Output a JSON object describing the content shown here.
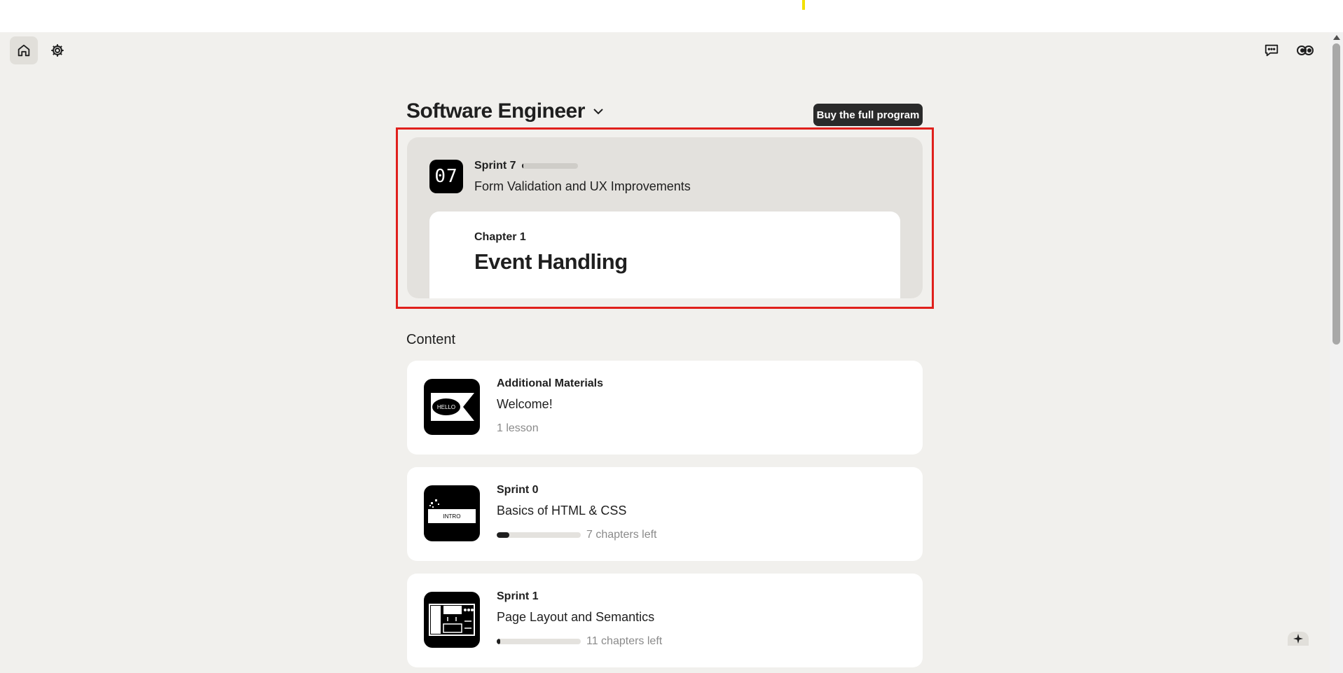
{
  "program": {
    "title": "Software Engineer",
    "buy_label": "Buy the full program"
  },
  "current_sprint": {
    "badge": "07",
    "label": "Sprint 7",
    "progress": 0.03,
    "name": "Form Validation and UX Improvements",
    "chapter_label": "Chapter 1",
    "chapter_title": "Event Handling"
  },
  "content": {
    "heading": "Content",
    "items": [
      {
        "kicker": "Additional Materials",
        "title": "Welcome!",
        "meta": "1 lesson",
        "thumb_text": "HELLO"
      },
      {
        "kicker": "Sprint 0",
        "title": "Basics of HTML & CSS",
        "meta": "7 chapters left",
        "progress": 0.15,
        "thumb_text": "INTRO"
      },
      {
        "kicker": "Sprint 1",
        "title": "Page Layout and Semantics",
        "meta": "11 chapters left",
        "progress": 0.04
      }
    ]
  },
  "icons": {
    "home": "home-icon",
    "settings": "gear-icon",
    "chat": "chat-icon",
    "mascot": "mascot-icon",
    "dropdown": "chevron-down-icon"
  },
  "colors": {
    "background": "#f1f0ed",
    "accent_dark": "#2a2a2a",
    "highlight": "#e0201c"
  }
}
